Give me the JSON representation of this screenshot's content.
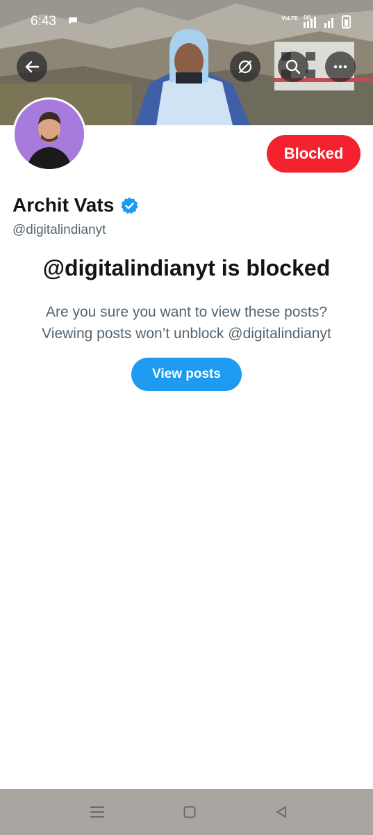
{
  "status_bar": {
    "time": "6:43",
    "network_label": "VoLTE",
    "network_type": "5G"
  },
  "header": {
    "icons": [
      "back-arrow-icon",
      "sync-icon",
      "search-icon",
      "more-icon"
    ]
  },
  "profile": {
    "name": "Archit Vats",
    "handle": "@digitalindianyt",
    "blocked_button_label": "Blocked",
    "verified": true
  },
  "blocked_notice": {
    "title": "@digitalindianyt is blocked",
    "line1": "Are you sure you want to view these posts?",
    "line2": "Viewing posts won’t unblock @digitalindianyt",
    "view_posts_label": "View posts"
  },
  "colors": {
    "blocked_red": "#f4212e",
    "twitter_blue": "#1d9bf0",
    "text_primary": "#0f1419",
    "text_secondary": "#536471"
  },
  "nav_bar": {
    "icons": [
      "menu-icon",
      "home-square-icon",
      "back-triangle-icon"
    ]
  }
}
